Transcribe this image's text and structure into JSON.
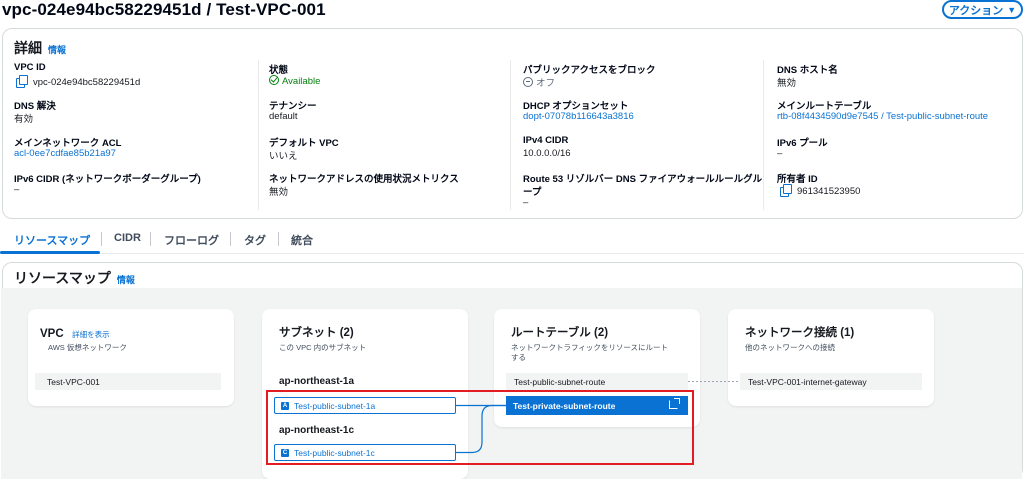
{
  "header": {
    "title": "vpc-024e94bc58229451d / Test-VPC-001",
    "actions_label": "アクション"
  },
  "details": {
    "title": "詳細",
    "info": "情報",
    "fields": {
      "vpc_id": {
        "label": "VPC ID",
        "value": "vpc-024e94bc58229451d"
      },
      "state": {
        "label": "状態",
        "value": "Available"
      },
      "block_public_access": {
        "label": "パブリックアクセスをブロック",
        "value": "オフ"
      },
      "dns_hostnames": {
        "label": "DNS ホスト名",
        "value": "無効"
      },
      "dns_resolution": {
        "label": "DNS 解決",
        "value": "有効"
      },
      "tenancy": {
        "label": "テナンシー",
        "value": "default"
      },
      "dhcp_option_set": {
        "label": "DHCP オプションセット",
        "value": "dopt-07078b116643a3816"
      },
      "main_route_table": {
        "label": "メインルートテーブル",
        "value": "rtb-08f4434590d9e7545 / Test-public-subnet-route"
      },
      "main_network_acl": {
        "label": "メインネットワーク ACL",
        "value": "acl-0ee7cdfae85b21a97"
      },
      "default_vpc": {
        "label": "デフォルト VPC",
        "value": "いいえ"
      },
      "ipv4_cidr": {
        "label": "IPv4 CIDR",
        "value": "10.0.0.0/16"
      },
      "ipv6_pool": {
        "label": "IPv6 プール",
        "value": "–"
      },
      "ipv6_cidr": {
        "label": "IPv6 CIDR (ネットワークボーダーグループ)",
        "value": "–"
      },
      "network_address_usage_metrics": {
        "label": "ネットワークアドレスの使用状況メトリクス",
        "value": "無効"
      },
      "route53_resolver_dns_firewall_label_line1": "Route 53 リゾルバー DNS ファイアウォールルールグル",
      "route53_resolver_dns_firewall_label_line2": "ープ",
      "route53_resolver_dns_firewall_value": "–",
      "owner_id": {
        "label": "所有者 ID",
        "value": "961341523950"
      }
    }
  },
  "tabs": [
    "リソースマップ",
    "CIDR",
    "フローログ",
    "タグ",
    "統合"
  ],
  "resource_map": {
    "title": "リソースマップ",
    "info": "情報",
    "vpc": {
      "title": "VPC",
      "details_link": "詳細を表示",
      "subtitle": "AWS 仮想ネットワーク",
      "item": "Test-VPC-001"
    },
    "subnets": {
      "title": "サブネット (2)",
      "subtitle": "この VPC 内のサブネット",
      "az1": {
        "name": "ap-northeast-1a",
        "badge": "A",
        "subnet": "Test-public-subnet-1a"
      },
      "az2": {
        "name": "ap-northeast-1c",
        "badge": "C",
        "subnet": "Test-public-subnet-1c"
      }
    },
    "route_tables": {
      "title": "ルートテーブル (2)",
      "subtitle_line1": "ネットワークトラフィックをリソースにルート",
      "subtitle_line2": "する",
      "items": [
        "Test-public-subnet-route",
        "Test-private-subnet-route"
      ]
    },
    "network_connections": {
      "title": "ネットワーク接続 (1)",
      "subtitle": "他のネットワークへの接続",
      "item": "Test-VPC-001-internet-gateway"
    }
  },
  "colors": {
    "accent": "#0972d3",
    "available": "#037f0c",
    "highlight": "#e31b23"
  }
}
